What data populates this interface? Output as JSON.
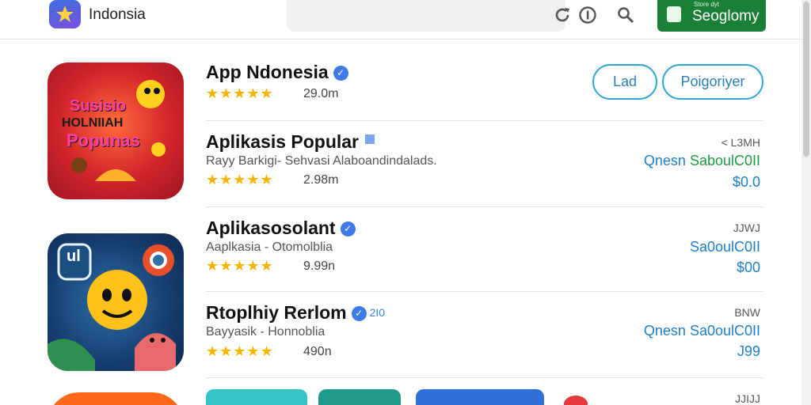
{
  "header": {
    "app_name": "Indonsia",
    "store_button": {
      "small": "Store dyt",
      "label": "Seoglomy"
    }
  },
  "apps": [
    {
      "title": "App Ndonesia",
      "rating_stars": "★★★★★",
      "size": "29.0m",
      "buttons": [
        "Lad",
        "Poigoriyer"
      ],
      "icon_text": [
        "Susisio",
        "HOLNIIAH",
        "Popunas"
      ]
    },
    {
      "title": "Aplikasis Popular",
      "subtitle": "Rayy Barkigi- Sehvasi Alaboandindalads.",
      "rating_stars": "★★★★★",
      "size": "2.98m",
      "right_small": "< L3MH",
      "right_label_a": "Qnesn",
      "right_label_b": "SaboulC0II",
      "price": "$0.0"
    },
    {
      "title": "Aplikasosolant",
      "subtitle": "Aaplkasia - Otomolblia",
      "rating_stars": "★★★★★",
      "size": "9.99n",
      "right_small": "JJWJ",
      "right_label_a": "Sa0oulC0II",
      "price": "$00",
      "icon_text": "ul"
    },
    {
      "title": "Rtoplhiy Rerlom",
      "extra": "2I0",
      "subtitle": "Bayyasik - Honnoblia",
      "rating_stars": "★★★★★",
      "size": "490n",
      "right_small": "BNW",
      "right_label_a": "Qnesn Sa0oulC0II",
      "price": "J99"
    }
  ],
  "footer_row": {
    "right_small": "JJIJJ"
  },
  "colors": {
    "accent": "#2fa7d6",
    "store_green": "#1a7f37",
    "star": "#f5b400",
    "verified": "#3f7be8"
  }
}
